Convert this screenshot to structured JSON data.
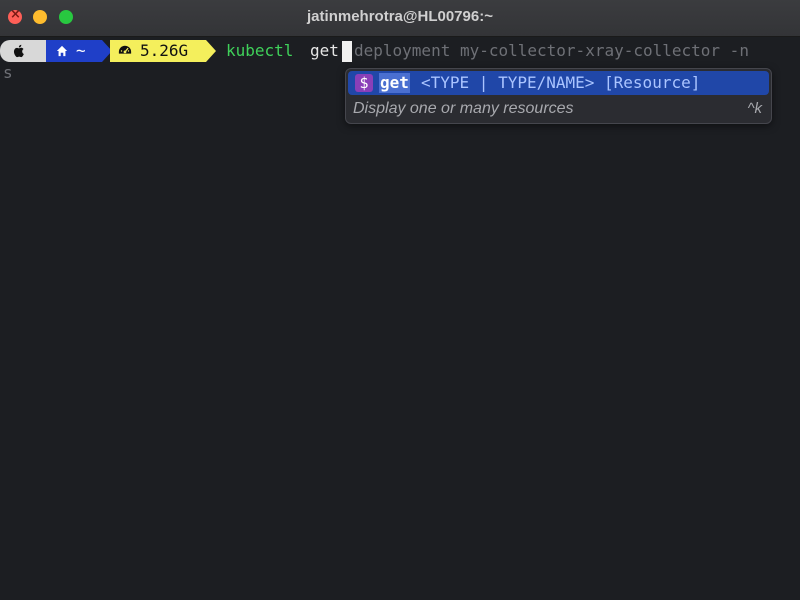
{
  "window": {
    "title": "jatinmehrotra@HL00796:~"
  },
  "prompt": {
    "apple_icon": "apple-icon",
    "home_icon": "home-icon",
    "home_path": "~",
    "memory_icon": "gauge-icon",
    "memory_value": "5.26G",
    "colors": {
      "apple_bg": "#d8d8d8",
      "home_bg": "#1f3fc8",
      "memory_bg": "#f4ef5c"
    }
  },
  "command": {
    "typed_program": "kubectl",
    "typed_arg": "get",
    "ghost_suggestion": "deployment my-collector-xray-collector -n",
    "wrapped_tail": "s"
  },
  "autocomplete": {
    "icon_label": "$",
    "match": "get",
    "args": "<TYPE | TYPE/NAME> [Resource]",
    "description": "Display one or many resources",
    "shortcut": "^k",
    "colors": {
      "selection": "#2047a8",
      "icon_bg": "#8a3fb8"
    }
  }
}
